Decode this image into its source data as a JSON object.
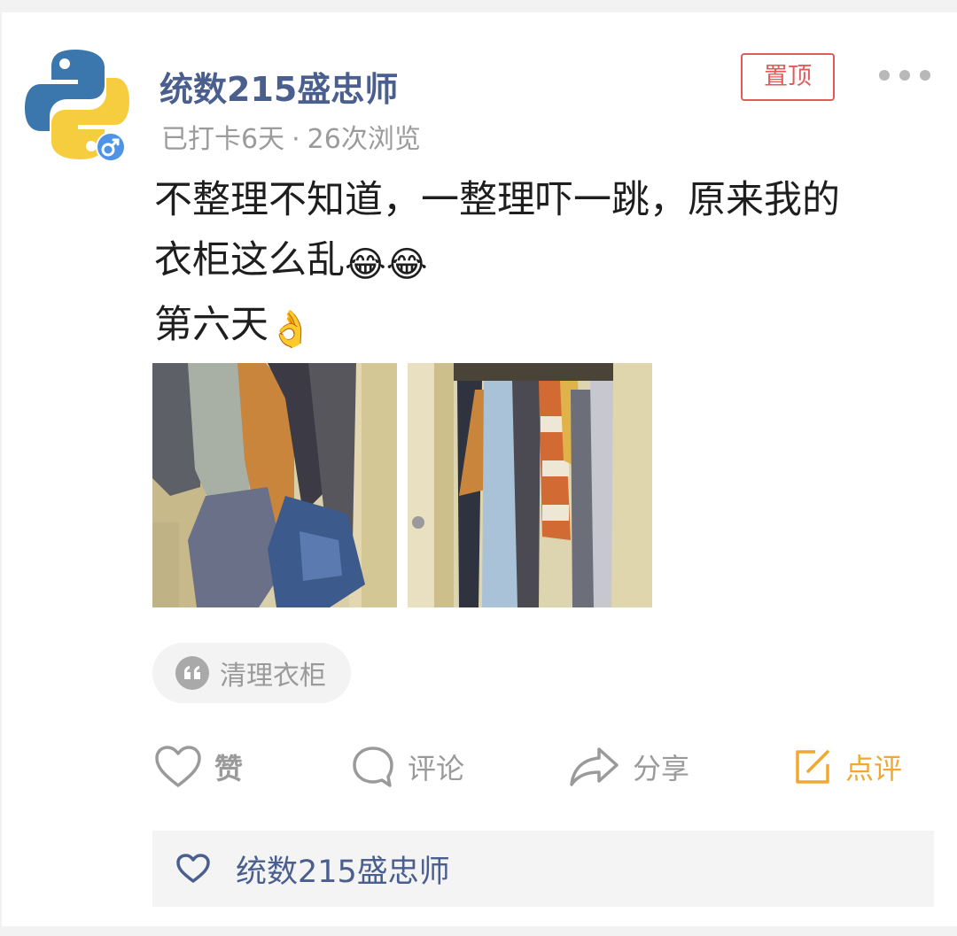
{
  "post": {
    "author": "统数215盛忠师",
    "checkin": "已打卡6天",
    "separator": "·",
    "views": "26次浏览",
    "pinned_label": "置顶",
    "text_line1": "不整理不知道，一整理吓一跳，原来我的",
    "text_line2": "衣柜这么乱",
    "text_line3": "第六天",
    "emoji_laugh": "😂",
    "emoji_ok": "👌",
    "topic": "清理衣柜"
  },
  "actions": {
    "like": "赞",
    "comment": "评论",
    "share": "分享",
    "review": "点评"
  },
  "likes": {
    "likers": "统数215盛忠师"
  },
  "colors": {
    "username": "#4a5f8e",
    "pinned": "#e25b5b",
    "review": "#f0a830",
    "meta": "#9b9b9b"
  },
  "icons": {
    "avatar": "python-logo",
    "gender": "male-icon",
    "more": "more-dots-icon",
    "topic": "quote-icon",
    "like": "heart-icon",
    "comment": "speech-bubble-icon",
    "share": "share-arrow-icon",
    "review": "edit-icon",
    "likes": "heart-outline-icon"
  }
}
